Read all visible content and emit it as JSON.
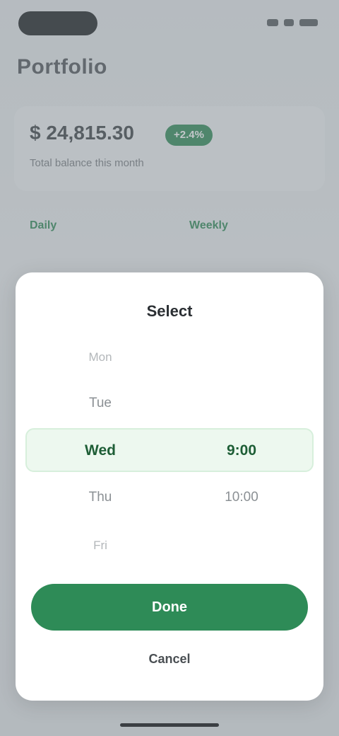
{
  "header": {
    "title": "Portfolio"
  },
  "summary": {
    "value": "$ 24,815.30",
    "badge": "+2.4%",
    "subtitle": "Total balance this month"
  },
  "tabs": [
    {
      "label": "Daily"
    },
    {
      "label": "Weekly"
    }
  ],
  "modal": {
    "title": "Select",
    "picker": {
      "left_column": [
        "Mon",
        "Tue",
        "Wed",
        "Thu",
        "Fri"
      ],
      "right_column": [
        "",
        "",
        "9:00",
        "10:00",
        ""
      ],
      "selected_index": 2
    },
    "confirm_label": "Done",
    "cancel_label": "Cancel"
  },
  "colors": {
    "accent": "#2e8b57",
    "selection_band": "#edf8ef",
    "overlay": "#787f88"
  },
  "icons": [
    "signal-icon",
    "wifi-icon",
    "battery-icon"
  ]
}
